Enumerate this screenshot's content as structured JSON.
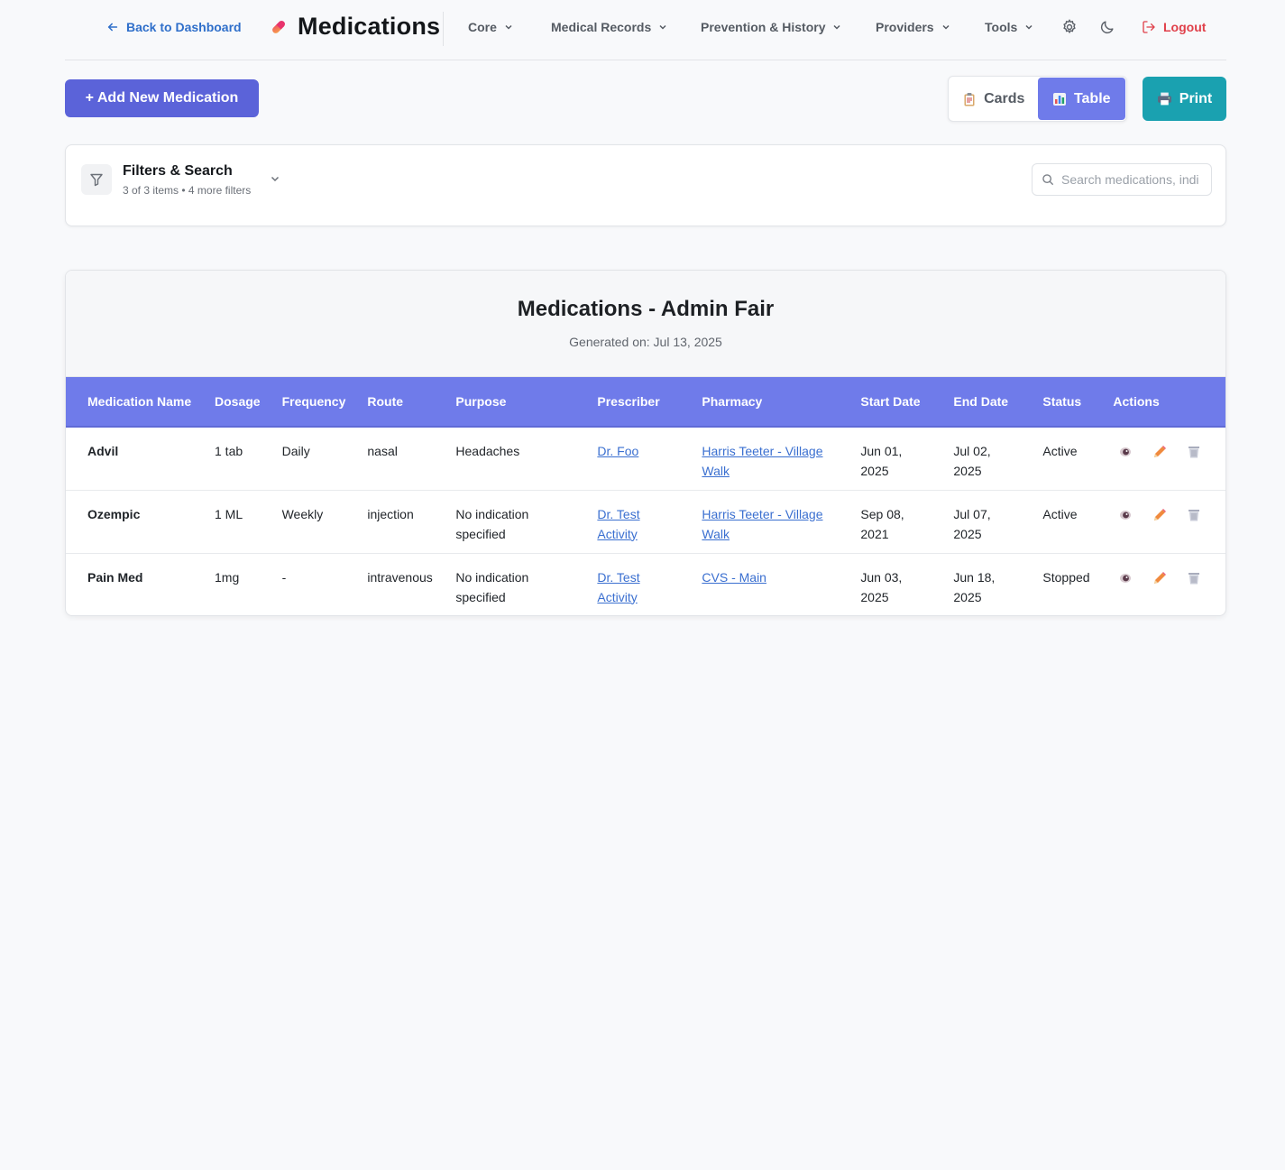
{
  "header": {
    "back_label": "Back to Dashboard",
    "title": "Medications",
    "nav": [
      {
        "label": "Core"
      },
      {
        "label": "Medical Records"
      },
      {
        "label": "Prevention & History"
      },
      {
        "label": "Providers"
      },
      {
        "label": "Tools"
      }
    ],
    "logout_label": "Logout",
    "icons": {
      "back": "arrow-left-icon",
      "brand": "pill-icon",
      "settings": "gear-icon",
      "theme": "moon-icon",
      "logout": "logout-icon"
    }
  },
  "toolbar": {
    "add_label": "+ Add New Medication",
    "view_cards_label": "Cards",
    "view_table_label": "Table",
    "active_view": "Table",
    "print_label": "Print"
  },
  "filters": {
    "title": "Filters & Search",
    "subtitle": "3 of 3 items • 4 more filters",
    "search_placeholder": "Search medications, indications..."
  },
  "report": {
    "title": "Medications - Admin Fair",
    "generated": "Generated on: Jul 13, 2025",
    "columns": [
      "Medication Name",
      "Dosage",
      "Frequency",
      "Route",
      "Purpose",
      "Prescriber",
      "Pharmacy",
      "Start Date",
      "End Date",
      "Status",
      "Actions"
    ],
    "rows": [
      {
        "name": "Advil",
        "dosage": "1 tab",
        "frequency": "Daily",
        "route": "nasal",
        "purpose": "Headaches",
        "prescriber": "Dr. Foo",
        "pharmacy": "Harris Teeter - Village Walk",
        "start": "Jun 01, 2025",
        "end": "Jul 02, 2025",
        "status": "Active"
      },
      {
        "name": "Ozempic",
        "dosage": "1 ML",
        "frequency": "Weekly",
        "route": "injection",
        "purpose": "No indication specified",
        "prescriber": "Dr. Test Activity",
        "pharmacy": "Harris Teeter - Village Walk",
        "start": "Sep 08, 2021",
        "end": "Jul 07, 2025",
        "status": "Active"
      },
      {
        "name": "Pain Med",
        "dosage": "1mg",
        "frequency": "-",
        "route": "intravenous",
        "purpose": "No indication specified",
        "prescriber": "Dr. Test Activity",
        "pharmacy": "CVS - Main",
        "start": "Jun 03, 2025",
        "end": "Jun 18, 2025",
        "status": "Stopped"
      }
    ],
    "action_icons": [
      "eye-icon",
      "pencil-icon",
      "trash-icon"
    ]
  },
  "colors": {
    "primary": "#5b63d9",
    "table_header": "#6f7bea",
    "print": "#1aa1b0",
    "logout": "#e0404a",
    "link": "#3a6fd0"
  }
}
